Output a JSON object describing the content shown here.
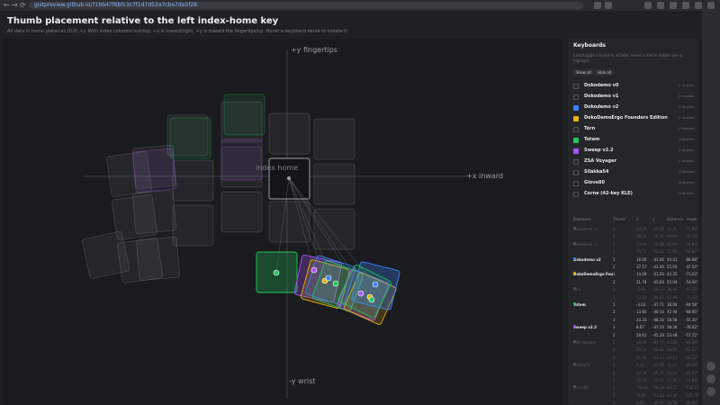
{
  "browser": {
    "url": "gistpreview.github.io/?1bb47f6bfc3c7f1d7d52a7cba7da5f28",
    "nav_back": "←",
    "nav_forward": "→",
    "nav_reload": "⟳"
  },
  "header": {
    "title": "Thumb placement relative to the left index-home key",
    "subtitle": "All data in home plates as (0,0),+y. With index columns out/top, +x is inward/right, +y is toward the fingertips/up. Hover a keyboard name to isolate it."
  },
  "plot": {
    "axis_top": "+y fingertips",
    "axis_bottom": "-y wrist",
    "axis_right": "+x inward",
    "index_home_label": "index home"
  },
  "panel": {
    "title": "Keyboards",
    "description": "Click/toggle a board to include. Hover a row to isolate one in highlight.",
    "show_all": "Show all",
    "hide_all": "Hide all",
    "keyboards": [
      {
        "name": "Dokodemo v0",
        "checked": false,
        "color": "#555555",
        "count": "2 thumbs"
      },
      {
        "name": "Dokodemo v1",
        "checked": false,
        "color": "#555555",
        "count": "2 thumbs"
      },
      {
        "name": "Dokodemo v2",
        "checked": true,
        "color": "#3b82f6",
        "count": "2 thumbs"
      },
      {
        "name": "DokoDemoErgo Founders Edition",
        "checked": true,
        "color": "#eab308",
        "count": "2 thumbs"
      },
      {
        "name": "Torn",
        "checked": false,
        "color": "#555555",
        "count": "3 thumbs"
      },
      {
        "name": "Totem",
        "checked": true,
        "color": "#22c55e",
        "count": "3 thumbs"
      },
      {
        "name": "Sweep v2.2",
        "checked": true,
        "color": "#a855f7",
        "count": "2 thumbs"
      },
      {
        "name": "ZSA Voyager",
        "checked": false,
        "color": "#555555",
        "count": "2 thumbs"
      },
      {
        "name": "Silakka54",
        "checked": false,
        "color": "#555555",
        "count": "3 thumbs"
      },
      {
        "name": "Glove80",
        "checked": false,
        "color": "#555555",
        "count": "6 thumbs"
      },
      {
        "name": "Corne (42-key KLE)",
        "checked": false,
        "color": "#555555",
        "count": "3 thumbs"
      }
    ],
    "table": {
      "headers": [
        "Keyboard",
        "Thumb",
        "x",
        "y",
        "Distance",
        "Angle"
      ],
      "rows": [
        {
          "kb": "Dokodemo v0",
          "thumb": "1",
          "x": "13.10",
          "y": "-40.28",
          "d": "42.35",
          "a": "-71.99°",
          "dim": true,
          "color": "#555555"
        },
        {
          "kb": "",
          "thumb": "2",
          "x": "28.41",
          "y": "-40.71",
          "d": "49.64",
          "a": "-55.10°",
          "dim": true,
          "color": "#555555"
        },
        {
          "kb": "Dokodemo v1",
          "thumb": "1",
          "x": "14.00",
          "y": "-40.28",
          "d": "42.64",
          "a": "-70.83°",
          "dim": true,
          "color": "#555555"
        },
        {
          "kb": "",
          "thumb": "2",
          "x": "29.72",
          "y": "-42.24",
          "d": "51.65",
          "a": "-54.87°",
          "dim": true,
          "color": "#555555"
        },
        {
          "kb": "Dokodemo v2",
          "thumb": "1",
          "x": "16.00",
          "y": "-41.00",
          "d": "44.01",
          "a": "-68.68°",
          "dim": false,
          "color": "#3b82f6"
        },
        {
          "kb": "",
          "thumb": "2",
          "x": "37.57",
          "y": "-41.06",
          "d": "55.65",
          "a": "-47.54°",
          "dim": false,
          "color": "#3b82f6"
        },
        {
          "kb": "DokoDemoErgo Founders Edition",
          "thumb": "1",
          "x": "14.09",
          "y": "-41.00",
          "d": "43.35",
          "a": "-71.03°",
          "dim": false,
          "color": "#eab308"
        },
        {
          "kb": "",
          "thumb": "2",
          "x": "31.74",
          "y": "-45.04",
          "d": "55.04",
          "a": "-54.84°",
          "dim": false,
          "color": "#eab308"
        },
        {
          "kb": "Torn",
          "thumb": "1",
          "x": "-5.05",
          "y": "-38.13",
          "d": "38.46",
          "a": "-97.55°",
          "dim": true,
          "color": "#555555"
        },
        {
          "kb": "",
          "thumb": "2",
          "x": "13.71",
          "y": "-40.21",
          "d": "42.48",
          "a": "-71.17°",
          "dim": true,
          "color": "#555555"
        },
        {
          "kb": "Totem",
          "thumb": "1",
          "x": "-3.02",
          "y": "-37.71",
          "d": "38.04",
          "a": "-94.58°",
          "dim": false,
          "color": "#22c55e"
        },
        {
          "kb": "",
          "thumb": "2",
          "x": "13.66",
          "y": "-40.16",
          "d": "42.44",
          "a": "-68.95°",
          "dim": false,
          "color": "#22c55e"
        },
        {
          "kb": "",
          "thumb": "3",
          "x": "33.33",
          "y": "-48.16",
          "d": "58.58",
          "a": "-55.30°",
          "dim": false,
          "color": "#22c55e"
        },
        {
          "kb": "Sweep v2.2",
          "thumb": "1",
          "x": "8.67",
          "y": "-37.33",
          "d": "38.36",
          "a": "-76.02°",
          "dim": false,
          "color": "#a855f7"
        },
        {
          "kb": "",
          "thumb": "2",
          "x": "28.61",
          "y": "-45.29",
          "d": "53.48",
          "a": "-57.72°",
          "dim": false,
          "color": "#a855f7"
        },
        {
          "kb": "ZSA Voyager",
          "thumb": "1",
          "x": "16.16",
          "y": "-41.77",
          "d": "44.80",
          "a": "-68.86°",
          "dim": true,
          "color": "#555555"
        },
        {
          "kb": "",
          "thumb": "2",
          "x": "33.54",
          "y": "-48.01",
          "d": "58.56",
          "a": "-55.07°",
          "dim": true,
          "color": "#555555"
        },
        {
          "kb": "",
          "thumb": "3",
          "x": "42.06",
          "y": "-43.13",
          "d": "60.11",
          "a": "-46.32°",
          "dim": true,
          "color": "#555555"
        },
        {
          "kb": "Silakka54",
          "thumb": "1",
          "x": "1.11",
          "y": "-42.06",
          "d": "42.07",
          "a": "-88.48°",
          "dim": true,
          "color": "#555555"
        },
        {
          "kb": "",
          "thumb": "2",
          "x": "20.38",
          "y": "-45.70",
          "d": "50.04",
          "a": "-65.97°",
          "dim": true,
          "color": "#555555"
        },
        {
          "kb": "",
          "thumb": "3",
          "x": "35.76",
          "y": "-45.43",
          "d": "57.82",
          "a": "-51.80°",
          "dim": true,
          "color": "#555555"
        },
        {
          "kb": "Glove80",
          "thumb": "1",
          "x": "-20.40",
          "y": "-38.10",
          "d": "43.22",
          "a": "-118.17°",
          "dim": true,
          "color": "#555555"
        },
        {
          "kb": "",
          "thumb": "2",
          "x": "-8.85",
          "y": "-43.50",
          "d": "44.39",
          "a": "-101.50°",
          "dim": true,
          "color": "#555555"
        },
        {
          "kb": "",
          "thumb": "3",
          "x": "0.00",
          "y": "-49.50",
          "d": "49.50",
          "a": "-90.00°",
          "dim": true,
          "color": "#555555"
        }
      ]
    }
  }
}
